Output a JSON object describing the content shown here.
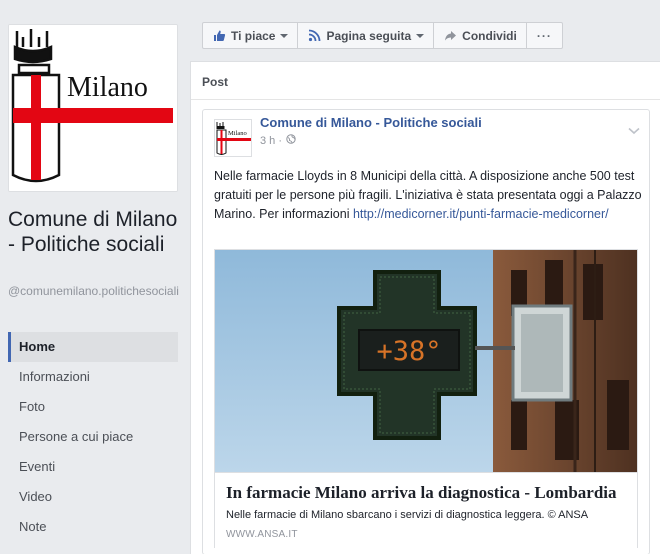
{
  "page": {
    "name": "Comune di Milano - Politiche sociali",
    "handle": "@comunemilano.politichesociali",
    "logo_text": "Milano"
  },
  "nav": [
    {
      "label": "Home",
      "active": true
    },
    {
      "label": "Informazioni",
      "active": false
    },
    {
      "label": "Foto",
      "active": false
    },
    {
      "label": "Persone a cui piace",
      "active": false
    },
    {
      "label": "Eventi",
      "active": false
    },
    {
      "label": "Video",
      "active": false
    },
    {
      "label": "Note",
      "active": false
    }
  ],
  "actions": {
    "like_label": "Ti piace",
    "follow_label": "Pagina seguita",
    "share_label": "Condividi",
    "more_label": "···"
  },
  "feed": {
    "heading": "Post",
    "post": {
      "author": "Comune di Milano - Politiche sociali",
      "time": "3 h ·",
      "text": "Nelle farmacie Lloyds in 8 Municipi della città. A disposizione anche 500 test gratuiti per le persone più fragili. L'iniziativa è stata presentata oggi a Palazzo Marino. Per informazioni ",
      "link": "http://medicorner.it/punti-farmacie-medicorner/",
      "preview": {
        "title": "In farmacie Milano arriva la diagnostica - Lombardia",
        "description": "Nelle farmacie di Milano sbarcano i servizi di diagnostica leggera. © ANSA",
        "domain": "WWW.ANSA.IT",
        "sign_text": "+38°"
      }
    }
  },
  "colors": {
    "brand_blue": "#4267b2",
    "link_blue": "#365899",
    "milano_red": "#e30613"
  }
}
